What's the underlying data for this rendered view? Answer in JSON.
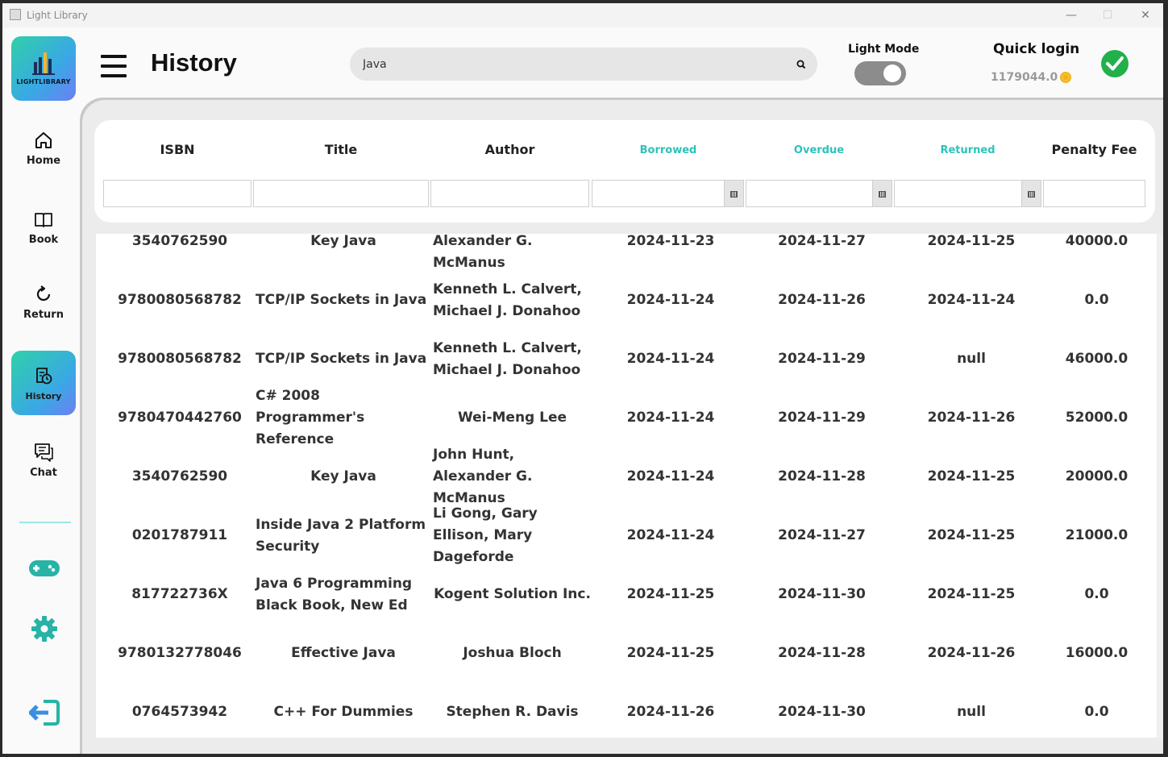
{
  "window": {
    "title": "Light Library",
    "min": "—",
    "max": "☐",
    "close": "✕"
  },
  "logo": {
    "text": "LIGHTLIBRARY"
  },
  "sidebar": {
    "items": [
      {
        "label": "Home",
        "icon": "home-icon"
      },
      {
        "label": "Book",
        "icon": "book-icon"
      },
      {
        "label": "Return",
        "icon": "return-icon"
      },
      {
        "label": "History",
        "icon": "history-icon",
        "active": true
      },
      {
        "label": "Chat",
        "icon": "chat-icon"
      }
    ],
    "extra_icons": [
      "gamepad-icon",
      "gear-icon",
      "logout-icon"
    ]
  },
  "header": {
    "title": "History",
    "search_value": "Java",
    "light_mode_label": "Light Mode",
    "light_mode_on": true,
    "quick_login_label": "Quick login",
    "balance": "1179044.0"
  },
  "table": {
    "columns": [
      "ISBN",
      "Title",
      "Author",
      "Borrowed",
      "Overdue",
      "Returned",
      "Penalty Fee"
    ],
    "rows": [
      {
        "isbn": "3540762590",
        "title": "Key Java",
        "author": "John Hunt, Alexander G. McManus",
        "borrowed": "2024-11-23",
        "overdue": "2024-11-27",
        "returned": "2024-11-25",
        "fee": "40000.0"
      },
      {
        "isbn": "9780080568782",
        "title": "TCP/IP Sockets in Java",
        "author": "Kenneth L. Calvert, Michael J. Donahoo",
        "borrowed": "2024-11-24",
        "overdue": "2024-11-26",
        "returned": "2024-11-24",
        "fee": "0.0"
      },
      {
        "isbn": "9780080568782",
        "title": "TCP/IP Sockets in Java",
        "author": "Kenneth L. Calvert, Michael J. Donahoo",
        "borrowed": "2024-11-24",
        "overdue": "2024-11-29",
        "returned": "null",
        "fee": "46000.0"
      },
      {
        "isbn": "9780470442760",
        "title": "C# 2008 Programmer's Reference",
        "author": "Wei-Meng Lee",
        "borrowed": "2024-11-24",
        "overdue": "2024-11-29",
        "returned": "2024-11-26",
        "fee": "52000.0"
      },
      {
        "isbn": "3540762590",
        "title": "Key Java",
        "author": "John Hunt, Alexander G. McManus",
        "borrowed": "2024-11-24",
        "overdue": "2024-11-28",
        "returned": "2024-11-25",
        "fee": "20000.0"
      },
      {
        "isbn": "0201787911",
        "title": "Inside Java 2 Platform Security",
        "author": "Li Gong, Gary Ellison, Mary Dageforde",
        "borrowed": "2024-11-24",
        "overdue": "2024-11-27",
        "returned": "2024-11-25",
        "fee": "21000.0"
      },
      {
        "isbn": "817722736X",
        "title": "Java 6 Programming Black Book, New Ed",
        "author": "Kogent Solution Inc.",
        "borrowed": "2024-11-25",
        "overdue": "2024-11-30",
        "returned": "2024-11-25",
        "fee": "0.0"
      },
      {
        "isbn": "9780132778046",
        "title": "Effective Java",
        "author": "Joshua Bloch",
        "borrowed": "2024-11-25",
        "overdue": "2024-11-28",
        "returned": "2024-11-26",
        "fee": "16000.0"
      },
      {
        "isbn": "0764573942",
        "title": "C++ For Dummies",
        "author": "Stephen R. Davis",
        "borrowed": "2024-11-26",
        "overdue": "2024-11-30",
        "returned": "null",
        "fee": "0.0"
      }
    ]
  },
  "colors": {
    "accent_teal": "#2cc3b8",
    "success_green": "#22b04b",
    "coin_gold": "#f2b31a"
  }
}
